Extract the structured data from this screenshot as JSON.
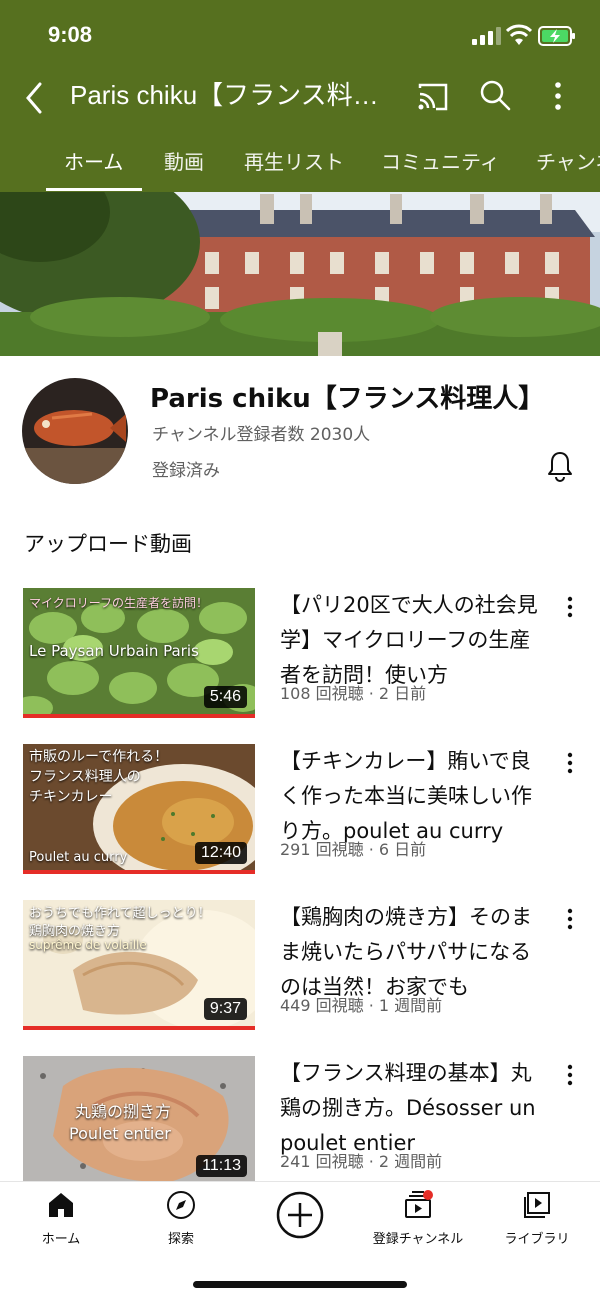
{
  "status": {
    "time": "9:08"
  },
  "appbar": {
    "title": "Paris chiku【フランス料理人】"
  },
  "tabs": [
    {
      "label": "ホーム"
    },
    {
      "label": "動画"
    },
    {
      "label": "再生リスト"
    },
    {
      "label": "コミュニティ"
    },
    {
      "label": "チャンネル"
    }
  ],
  "channel": {
    "name": "Paris chiku【フランス料理人】",
    "subscribers": "チャンネル登録者数 2030人",
    "subscribed": "登録済み"
  },
  "section": {
    "title": "アップロード動画"
  },
  "videos": [
    {
      "title": "【パリ20区で大人の社会見学】マイクロリーフの生産者を訪問！使い方",
      "meta": "108 回視聴 · 2 日前",
      "duration": "5:46",
      "thumb_line1": "マイクロリーフの生産者を訪問！",
      "thumb_line2": "Le Paysan Urbain Paris"
    },
    {
      "title": "【チキンカレー】賄いで良く作った本当に美味しい作り方。poulet au curry",
      "meta": "291 回視聴 · 6 日前",
      "duration": "12:40",
      "thumb_line1": "市販のルーで作れる！",
      "thumb_line2": "フランス料理人の",
      "thumb_line3": "チキンカレー",
      "thumb_line4": "Poulet au curry"
    },
    {
      "title": "【鶏胸肉の焼き方】そのまま焼いたらパサパサになるのは当然！お家でも",
      "meta": "449 回視聴 · 1 週間前",
      "duration": "9:37",
      "thumb_line1": "おうちでも作れて超しっとり！",
      "thumb_line2": "鶏胸肉の焼き方",
      "thumb_line3": "suprême de volaille"
    },
    {
      "title": "【フランス料理の基本】丸鶏の捌き方。Désosser un poulet entier",
      "meta": "241 回視聴 · 2 週間前",
      "duration": "11:13",
      "thumb_line1": "丸鶏の捌き方",
      "thumb_line2": "Poulet entier"
    }
  ],
  "bottomnav": [
    {
      "label": "ホーム",
      "icon": "home-icon"
    },
    {
      "label": "探索",
      "icon": "compass-icon"
    },
    {
      "label": "",
      "icon": "create-icon"
    },
    {
      "label": "登録チャンネル",
      "icon": "subscriptions-icon"
    },
    {
      "label": "ライブラリ",
      "icon": "library-icon"
    }
  ],
  "colors": {
    "header": "#56701f",
    "accent": "#e52d27"
  }
}
